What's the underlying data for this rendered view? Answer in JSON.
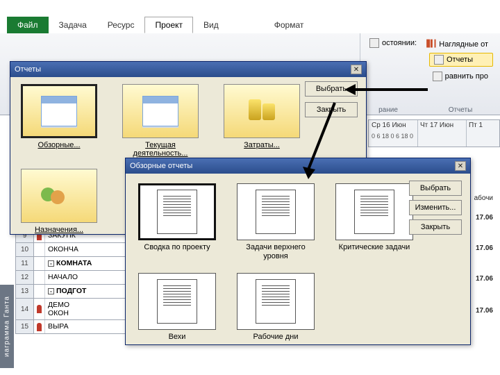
{
  "ribbon": {
    "file": "Файл",
    "tabs": [
      "Задача",
      "Ресурс",
      "Проект",
      "Вид",
      "Формат"
    ],
    "active_index": 2,
    "group": {
      "status_label": "остоянии:",
      "visual_reports": "Наглядные от",
      "reports": "Отчеты",
      "compare": "равнить про",
      "glabel": "Отчеты",
      "plabel": "рание"
    }
  },
  "timeline": {
    "days": [
      "Ср 16 Июн",
      "Чт 17 Июн",
      "Пт 1"
    ],
    "hours": "0   6   18   0   6   18   0"
  },
  "tasks": [
    {
      "n": "9",
      "ind": true,
      "name": "ЗАКУПК"
    },
    {
      "n": "10",
      "ind": false,
      "name": "ОКОНЧА"
    },
    {
      "n": "11",
      "ind": false,
      "name": "КОМНАТА",
      "exp": "-",
      "bold": true
    },
    {
      "n": "12",
      "ind": false,
      "name": "НАЧАЛО"
    },
    {
      "n": "13",
      "ind": false,
      "name": "ПОДГОТ",
      "exp": "-",
      "bold": true
    },
    {
      "n": "14",
      "ind": true,
      "name": "ДЕМО\nОКОН"
    },
    {
      "n": "15",
      "ind": true,
      "name": "ВЫРА"
    }
  ],
  "side_label": "иаграмма Ганта",
  "gantt_values": [
    "абочи",
    "17.06",
    "17.06",
    "17.06",
    "17.06"
  ],
  "dlg1": {
    "title": "Отчеты",
    "items_r1": [
      "Обзорные...",
      "Текущая деятельность...",
      "Затраты..."
    ],
    "items_r2": [
      "Назначения..."
    ],
    "btn_select": "Выбрать",
    "btn_close": "Закрыть"
  },
  "dlg2": {
    "title": "Обзорные отчеты",
    "items_r1": [
      "Сводка по проекту",
      "Задачи верхнего уровня",
      "Критические задачи"
    ],
    "items_r2": [
      "Вехи",
      "Рабочие дни"
    ],
    "btn_select": "Выбрать",
    "btn_edit": "Изменить...",
    "btn_close": "Закрыть"
  }
}
